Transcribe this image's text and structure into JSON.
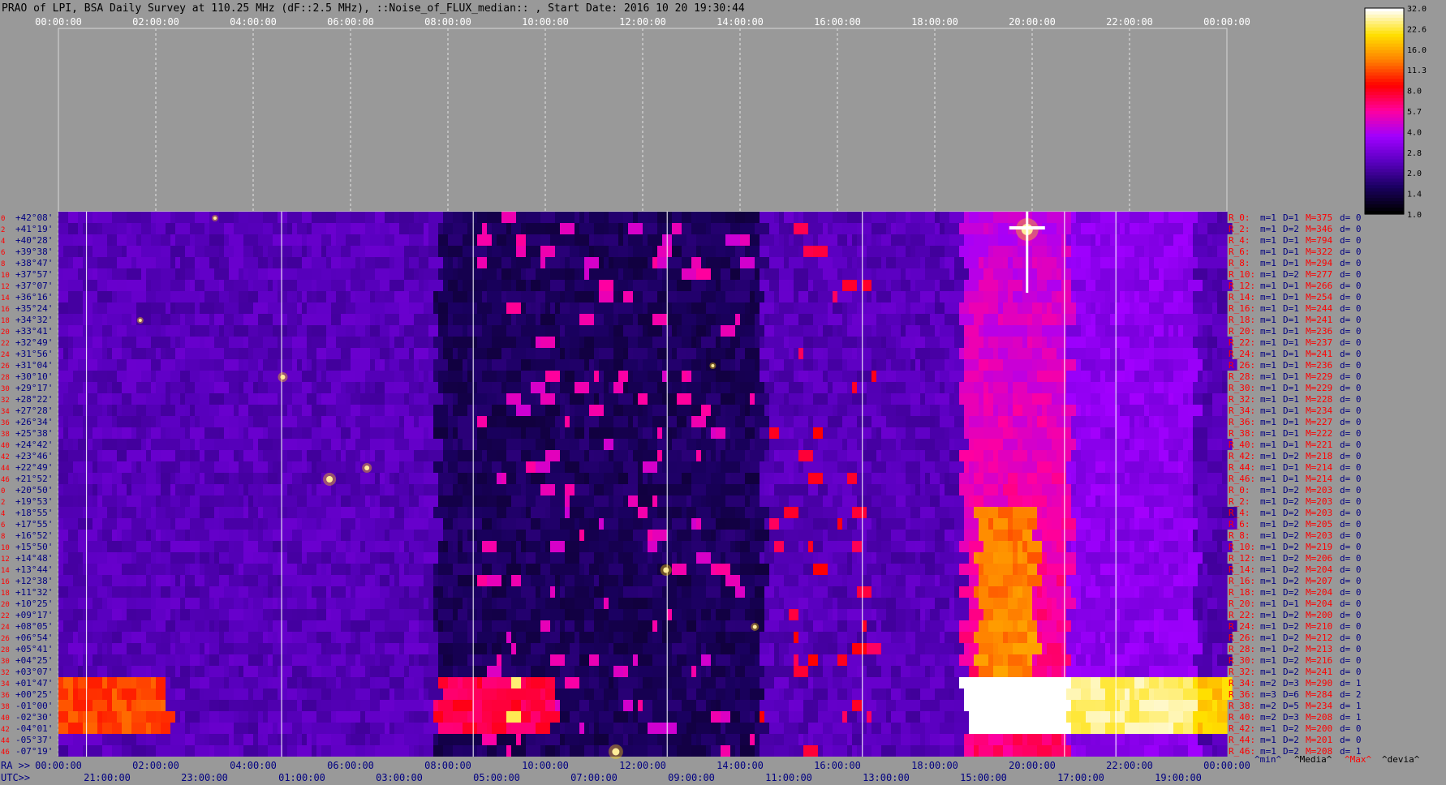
{
  "title": "PRAO of LPI, BSA Daily Survey at 110.25 MHz (dF::2.5 MHz), ::Noise_of_FLUX_median:: , Start Date: 2016 10 20 19:30:44",
  "chart_data": {
    "type": "heatmap",
    "top_time_labels": [
      "00:00:00",
      "02:00:00",
      "04:00:00",
      "06:00:00",
      "08:00:00",
      "10:00:00",
      "12:00:00",
      "14:00:00",
      "16:00:00",
      "18:00:00",
      "20:00:00",
      "22:00:00",
      "00:00:00"
    ],
    "ra_axis_label": "RA >>",
    "ra_labels": [
      "00:00:00",
      "02:00:00",
      "04:00:00",
      "06:00:00",
      "08:00:00",
      "10:00:00",
      "12:00:00",
      "14:00:00",
      "16:00:00",
      "18:00:00",
      "20:00:00",
      "22:00:00",
      "00:00:00"
    ],
    "utc_axis_label": "UTC>>",
    "utc_labels": [
      "21:00:00",
      "23:00:00",
      "01:00:00",
      "03:00:00",
      "05:00:00",
      "07:00:00",
      "09:00:00",
      "11:00:00",
      "13:00:00",
      "15:00:00",
      "17:00:00",
      "19:00:00"
    ],
    "declinations": [
      "+42°08'",
      "+41°19'",
      "+40°28'",
      "+39°38'",
      "+38°47'",
      "+37°57'",
      "+37°07'",
      "+36°16'",
      "+35°24'",
      "+34°32'",
      "+33°41'",
      "+32°49'",
      "+31°56'",
      "+31°04'",
      "+30°10'",
      "+29°17'",
      "+28°22'",
      "+27°28'",
      "+26°34'",
      "+25°38'",
      "+24°42'",
      "+23°46'",
      "+22°49'",
      "+21°52'",
      "+20°50'",
      "+19°53'",
      "+18°55'",
      "+17°55'",
      "+16°52'",
      "+15°50'",
      "+14°48'",
      "+13°44'",
      "+12°38'",
      "+11°32'",
      "+10°25'",
      "+09°17'",
      "+08°05'",
      "+06°54'",
      "+05°41'",
      "+04°25'",
      "+03°07'",
      "+01°47'",
      "+00°25'",
      "-01°00'",
      "-02°30'",
      "-04°01'",
      "-05°37'",
      "-07°19'"
    ],
    "row_indices": [
      "0",
      "2",
      "4",
      "6",
      "8",
      "10",
      "12",
      "14",
      "16",
      "18",
      "20",
      "22",
      "24",
      "26",
      "28",
      "30",
      "32",
      "34",
      "36",
      "38",
      "40",
      "42",
      "44",
      "46",
      "0",
      "2",
      "4",
      "6",
      "8",
      "10",
      "12",
      "14",
      "16",
      "18",
      "20",
      "22",
      "24",
      "26",
      "28",
      "30",
      "32",
      "34",
      "36",
      "38",
      "40",
      "42",
      "44",
      "46"
    ],
    "beam_stats": [
      {
        "r": "R_0:",
        "m": "m=1",
        "D": "D=1",
        "M": "M=375",
        "d": "d= 0"
      },
      {
        "r": "R_2:",
        "m": "m=1",
        "D": "D=2",
        "M": "M=346",
        "d": "d= 0"
      },
      {
        "r": "R_4:",
        "m": "m=1",
        "D": "D=1",
        "M": "M=794",
        "d": "d= 0"
      },
      {
        "r": "R_6:",
        "m": "m=1",
        "D": "D=1",
        "M": "M=322",
        "d": "d= 0"
      },
      {
        "r": "R_8:",
        "m": "m=1",
        "D": "D=1",
        "M": "M=294",
        "d": "d= 0"
      },
      {
        "r": "R_10:",
        "m": "m=1",
        "D": "D=2",
        "M": "M=277",
        "d": "d= 0"
      },
      {
        "r": "R_12:",
        "m": "m=1",
        "D": "D=1",
        "M": "M=266",
        "d": "d= 0"
      },
      {
        "r": "R_14:",
        "m": "m=1",
        "D": "D=1",
        "M": "M=254",
        "d": "d= 0"
      },
      {
        "r": "R_16:",
        "m": "m=1",
        "D": "D=1",
        "M": "M=244",
        "d": "d= 0"
      },
      {
        "r": "R_18:",
        "m": "m=1",
        "D": "D=1",
        "M": "M=241",
        "d": "d= 0"
      },
      {
        "r": "R_20:",
        "m": "m=1",
        "D": "D=1",
        "M": "M=236",
        "d": "d= 0"
      },
      {
        "r": "R_22:",
        "m": "m=1",
        "D": "D=1",
        "M": "M=237",
        "d": "d= 0"
      },
      {
        "r": "R_24:",
        "m": "m=1",
        "D": "D=1",
        "M": "M=241",
        "d": "d= 0"
      },
      {
        "r": "R_26:",
        "m": "m=1",
        "D": "D=1",
        "M": "M=236",
        "d": "d= 0"
      },
      {
        "r": "R_28:",
        "m": "m=1",
        "D": "D=1",
        "M": "M=229",
        "d": "d= 0"
      },
      {
        "r": "R_30:",
        "m": "m=1",
        "D": "D=1",
        "M": "M=229",
        "d": "d= 0"
      },
      {
        "r": "R_32:",
        "m": "m=1",
        "D": "D=1",
        "M": "M=228",
        "d": "d= 0"
      },
      {
        "r": "R_34:",
        "m": "m=1",
        "D": "D=1",
        "M": "M=234",
        "d": "d= 0"
      },
      {
        "r": "R_36:",
        "m": "m=1",
        "D": "D=1",
        "M": "M=227",
        "d": "d= 0"
      },
      {
        "r": "R_38:",
        "m": "m=1",
        "D": "D=1",
        "M": "M=222",
        "d": "d= 0"
      },
      {
        "r": "R_40:",
        "m": "m=1",
        "D": "D=1",
        "M": "M=221",
        "d": "d= 0"
      },
      {
        "r": "R_42:",
        "m": "m=1",
        "D": "D=2",
        "M": "M=218",
        "d": "d= 0"
      },
      {
        "r": "R_44:",
        "m": "m=1",
        "D": "D=1",
        "M": "M=214",
        "d": "d= 0"
      },
      {
        "r": "R_46:",
        "m": "m=1",
        "D": "D=1",
        "M": "M=214",
        "d": "d= 0"
      },
      {
        "r": "R_0:",
        "m": "m=1",
        "D": "D=2",
        "M": "M=203",
        "d": "d= 0"
      },
      {
        "r": "R_2:",
        "m": "m=1",
        "D": "D=2",
        "M": "M=203",
        "d": "d= 0"
      },
      {
        "r": "R_4:",
        "m": "m=1",
        "D": "D=2",
        "M": "M=203",
        "d": "d= 0"
      },
      {
        "r": "R_6:",
        "m": "m=1",
        "D": "D=2",
        "M": "M=205",
        "d": "d= 0"
      },
      {
        "r": "R_8:",
        "m": "m=1",
        "D": "D=2",
        "M": "M=203",
        "d": "d= 0"
      },
      {
        "r": "R_10:",
        "m": "m=1",
        "D": "D=2",
        "M": "M=219",
        "d": "d= 0"
      },
      {
        "r": "R_12:",
        "m": "m=1",
        "D": "D=2",
        "M": "M=206",
        "d": "d= 0"
      },
      {
        "r": "R_14:",
        "m": "m=1",
        "D": "D=2",
        "M": "M=204",
        "d": "d= 0"
      },
      {
        "r": "R_16:",
        "m": "m=1",
        "D": "D=2",
        "M": "M=207",
        "d": "d= 0"
      },
      {
        "r": "R_18:",
        "m": "m=1",
        "D": "D=2",
        "M": "M=204",
        "d": "d= 0"
      },
      {
        "r": "R_20:",
        "m": "m=1",
        "D": "D=1",
        "M": "M=204",
        "d": "d= 0"
      },
      {
        "r": "R_22:",
        "m": "m=1",
        "D": "D=2",
        "M": "M=200",
        "d": "d= 0"
      },
      {
        "r": "R_24:",
        "m": "m=1",
        "D": "D=2",
        "M": "M=210",
        "d": "d= 0"
      },
      {
        "r": "R_26:",
        "m": "m=1",
        "D": "D=2",
        "M": "M=212",
        "d": "d= 0"
      },
      {
        "r": "R_28:",
        "m": "m=1",
        "D": "D=2",
        "M": "M=213",
        "d": "d= 0"
      },
      {
        "r": "R_30:",
        "m": "m=1",
        "D": "D=2",
        "M": "M=216",
        "d": "d= 0"
      },
      {
        "r": "R_32:",
        "m": "m=1",
        "D": "D=2",
        "M": "M=241",
        "d": "d= 0"
      },
      {
        "r": "R_34:",
        "m": "m=2",
        "D": "D=3",
        "M": "M=290",
        "d": "d= 1"
      },
      {
        "r": "R_36:",
        "m": "m=3",
        "D": "D=6",
        "M": "M=284",
        "d": "d= 2"
      },
      {
        "r": "R_38:",
        "m": "m=2",
        "D": "D=5",
        "M": "M=234",
        "d": "d= 1"
      },
      {
        "r": "R_40:",
        "m": "m=2",
        "D": "D=3",
        "M": "M=208",
        "d": "d= 1"
      },
      {
        "r": "R_42:",
        "m": "m=1",
        "D": "D=2",
        "M": "M=200",
        "d": "d= 0"
      },
      {
        "r": "R_44:",
        "m": "m=1",
        "D": "D=2",
        "M": "M=201",
        "d": "d= 0"
      },
      {
        "r": "R_46:",
        "m": "m=1",
        "D": "D=2",
        "M": "M=208",
        "d": "d= 1"
      }
    ],
    "stat_legend": [
      "^min^",
      "^Media^",
      "^Max^",
      "^devia^"
    ],
    "colorbar": {
      "ticks": [
        "32.0",
        "22.6",
        "16.0",
        "11.3",
        "8.0",
        "5.7",
        "4.0",
        "2.8",
        "2.0",
        "1.4",
        "1.0"
      ],
      "scale": "log",
      "range": [
        1.0,
        32.0
      ],
      "colormap": [
        "#000000",
        "#1a0060",
        "#5a00c0",
        "#a000ff",
        "#ff00a0",
        "#ff0000",
        "#ff8000",
        "#ffe000",
        "#ffffff"
      ]
    },
    "grid": true
  },
  "colors": {
    "background": "#999999",
    "text_dark": "#000000",
    "text_white": "#ffffff",
    "label_red": "#ff0000",
    "label_navy": "#000080",
    "max_red": "#ff0000"
  }
}
